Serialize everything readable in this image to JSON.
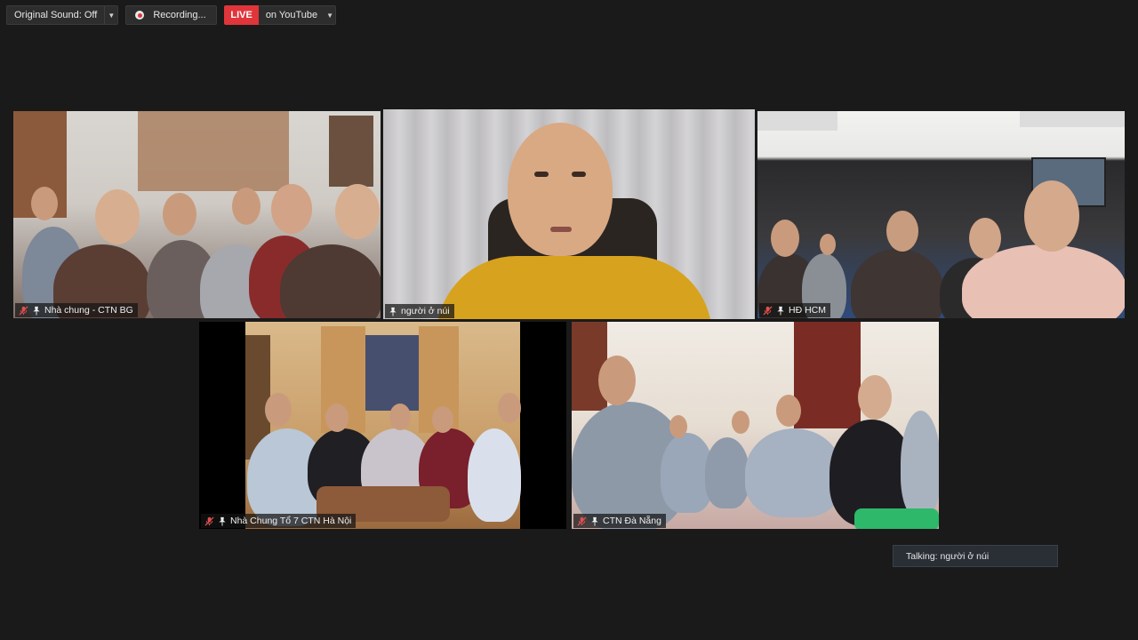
{
  "toolbar": {
    "original_sound_label": "Original Sound: Off",
    "recording_label": "Recording...",
    "live_badge": "LIVE",
    "stream_target_label": "on YouTube"
  },
  "participants": [
    {
      "name": "Nhà chung - CTN BG",
      "muted": true,
      "pinned": true
    },
    {
      "name": "người ở núi",
      "muted": false,
      "pinned": true,
      "active_speaker": true
    },
    {
      "name": "HĐ HCM",
      "muted": true,
      "pinned": true
    },
    {
      "name": "Nhà Chung Tổ 7 CTN Hà Nội",
      "muted": true,
      "pinned": true
    },
    {
      "name": "CTN Đà Nẵng",
      "muted": true,
      "pinned": true
    }
  ],
  "status": {
    "talking_label": "Talking: người ở núi"
  },
  "colors": {
    "background": "#1a1a1a",
    "live_red": "#e0353a",
    "active_speaker_border": "#b9d86a",
    "muted_red": "#e05050"
  },
  "icons": {
    "muted": "mic-muted-icon",
    "pinned": "pin-icon",
    "recording": "record-dot-icon",
    "dropdown": "chevron-down-icon"
  }
}
